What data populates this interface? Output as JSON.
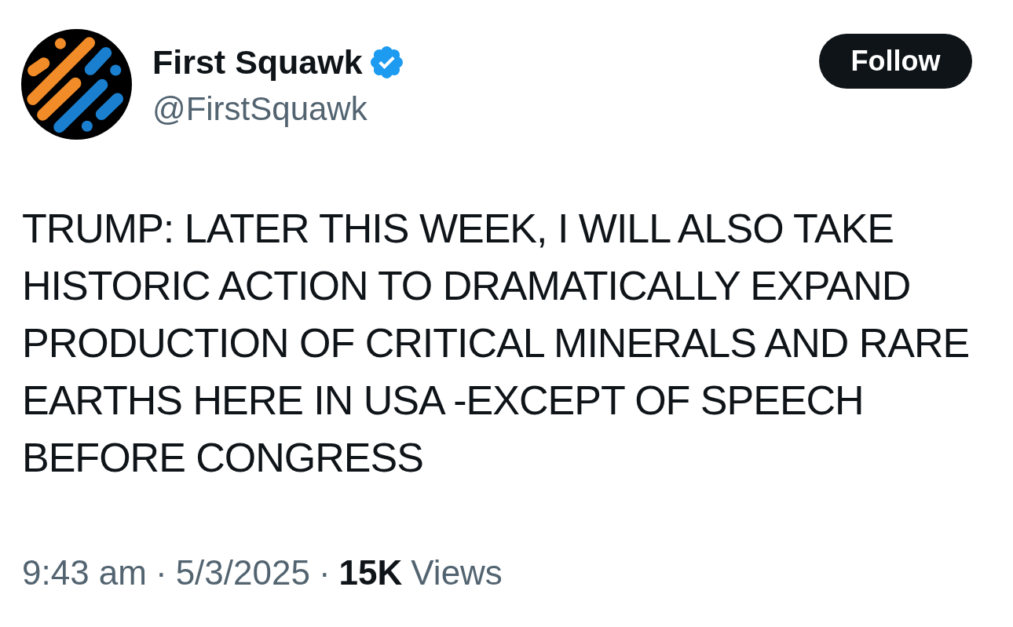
{
  "author": {
    "name": "First Squawk",
    "verified": true,
    "handle": "@FirstSquawk"
  },
  "follow_button": {
    "label": "Follow"
  },
  "post": {
    "text": "TRUMP: LATER THIS WEEK, I WILL ALSO TAKE HISTORIC ACTION TO DRAMATICALLY EXPAND PRODUCTION OF CRITICAL MINERALS AND RARE EARTHS HERE IN USA -EXCEPT OF SPEECH BEFORE CONGRESS"
  },
  "meta": [
    {
      "kind": "time",
      "text": "9:43 am"
    },
    {
      "kind": "separator",
      "text": "·"
    },
    {
      "kind": "date",
      "text": "5/3/2025"
    },
    {
      "kind": "separator",
      "text": "·"
    },
    {
      "kind": "count",
      "text": "15K"
    },
    {
      "kind": "label",
      "text": "Views"
    }
  ]
}
